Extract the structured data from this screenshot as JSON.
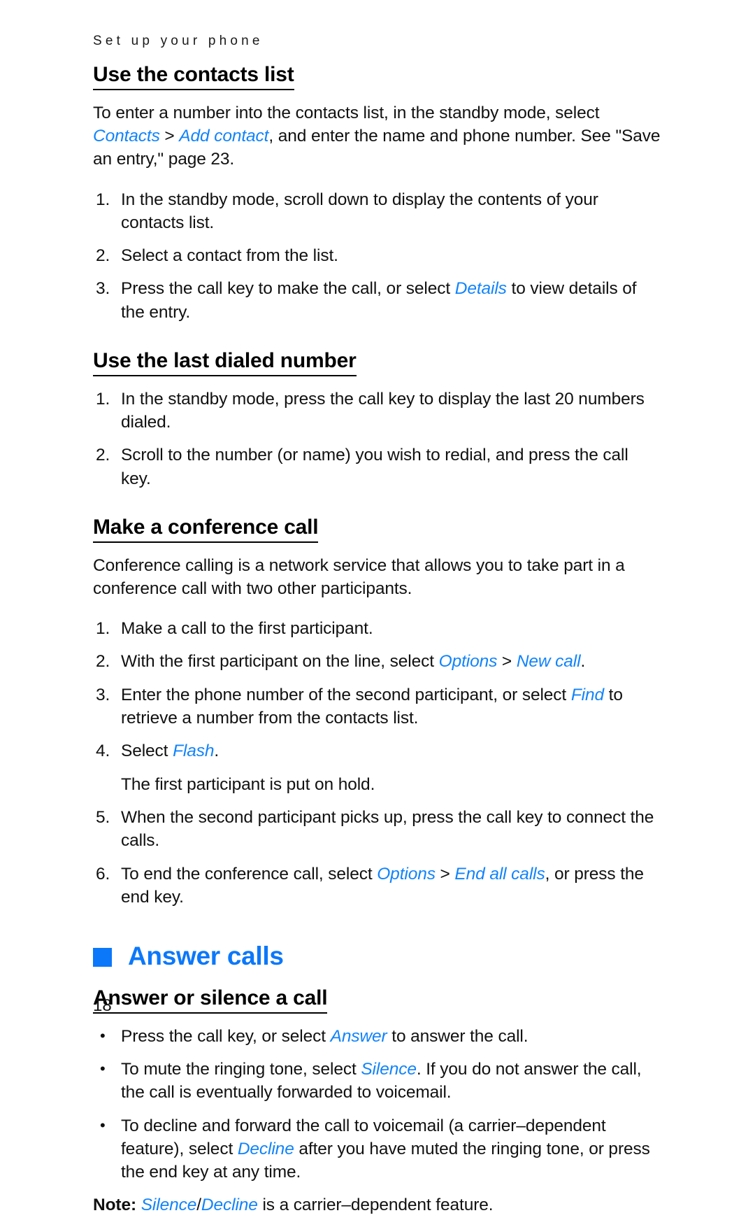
{
  "running_header": "Set up your phone",
  "page_number": "18",
  "colors": {
    "link_blue": "#1083fb",
    "chapter_blue": "#0b78fa",
    "text_black": "#111111"
  },
  "sections": [
    {
      "id": "use-contacts-list",
      "heading": "Use the contacts list",
      "intro": {
        "t1": "To enter a number into the contacts list, in the standby mode, select ",
        "ui1": "Contacts",
        "sep1": " > ",
        "ui2": "Add contact",
        "t2": ", and enter the name and phone number. See \"Save an entry,\" page 23."
      },
      "steps": [
        {
          "marker": "1.",
          "t1": "In the standby mode, scroll down to display the contents of your contacts list.",
          "ui1": "",
          "t2": ""
        },
        {
          "marker": "2.",
          "t1": "Select a contact from the list.",
          "ui1": "",
          "t2": ""
        },
        {
          "marker": "3.",
          "t1": "Press the call key to make the call, or select ",
          "ui1": "Details",
          "t2": " to view details of the entry."
        }
      ]
    },
    {
      "id": "use-last-dialed-number",
      "heading": "Use the last dialed number",
      "steps": [
        {
          "marker": "1.",
          "t1": "In the standby mode, press the call key to display the last 20 numbers dialed.",
          "ui1": "",
          "t2": ""
        },
        {
          "marker": "2.",
          "t1": "Scroll to the number (or name) you wish to redial, and press the call key.",
          "ui1": "",
          "t2": ""
        }
      ]
    },
    {
      "id": "make-conference-call",
      "heading": "Make a conference call",
      "intro": "Conference calling is a network service that allows you to take part in a conference call with two other participants.",
      "steps": [
        {
          "marker": "1.",
          "t1": "Make a call to the first participant.",
          "ui1": "",
          "sep1": "",
          "ui2": "",
          "t2": ""
        },
        {
          "marker": "2.",
          "t1": "With the first participant on the line, select ",
          "ui1": "Options",
          "sep1": " > ",
          "ui2": "New call",
          "t2": "."
        },
        {
          "marker": "3.",
          "t1": "Enter the phone number of the second participant, or select ",
          "ui1": "Find",
          "sep1": "",
          "ui2": "",
          "t2": " to retrieve a number from the contacts list."
        },
        {
          "marker": "4.",
          "t1": "Select ",
          "ui1": "Flash",
          "sep1": "",
          "ui2": "",
          "t2": "."
        },
        {
          "marker": "",
          "t1": "The first participant is put on hold.",
          "ui1": "",
          "sep1": "",
          "ui2": "",
          "t2": "",
          "is_note": true
        },
        {
          "marker": "5.",
          "t1": "When the second participant picks up, press the call key to connect the calls.",
          "ui1": "",
          "sep1": "",
          "ui2": "",
          "t2": ""
        },
        {
          "marker": "6.",
          "t1": "To end the conference call, select ",
          "ui1": "Options",
          "sep1": " > ",
          "ui2": "End all calls",
          "t2": ", or press the end key."
        }
      ]
    }
  ],
  "chapter": {
    "id": "answer-calls",
    "bullet": "square-bullet",
    "title": "Answer calls",
    "subsection": {
      "heading": "Answer or silence a call",
      "bullets": [
        {
          "marker": "•",
          "t1": "Press the call key, or select ",
          "ui1": "Answer",
          "t2": " to answer the call."
        },
        {
          "marker": "•",
          "t1": "To mute the ringing tone, select ",
          "ui1": "Silence",
          "t2": ". If you do not answer the call, the call is eventually forwarded to voicemail."
        },
        {
          "marker": "•",
          "t1": "To decline and forward the call to voicemail (a carrier–dependent feature), select ",
          "ui1": "Decline",
          "t2": " after you have muted the ringing tone, or press the end key at any time."
        }
      ],
      "note": {
        "label": "Note:",
        "ui1": "Silence",
        "slash": "/",
        "ui2": "Decline",
        "t2": " is a carrier–dependent feature."
      }
    }
  }
}
